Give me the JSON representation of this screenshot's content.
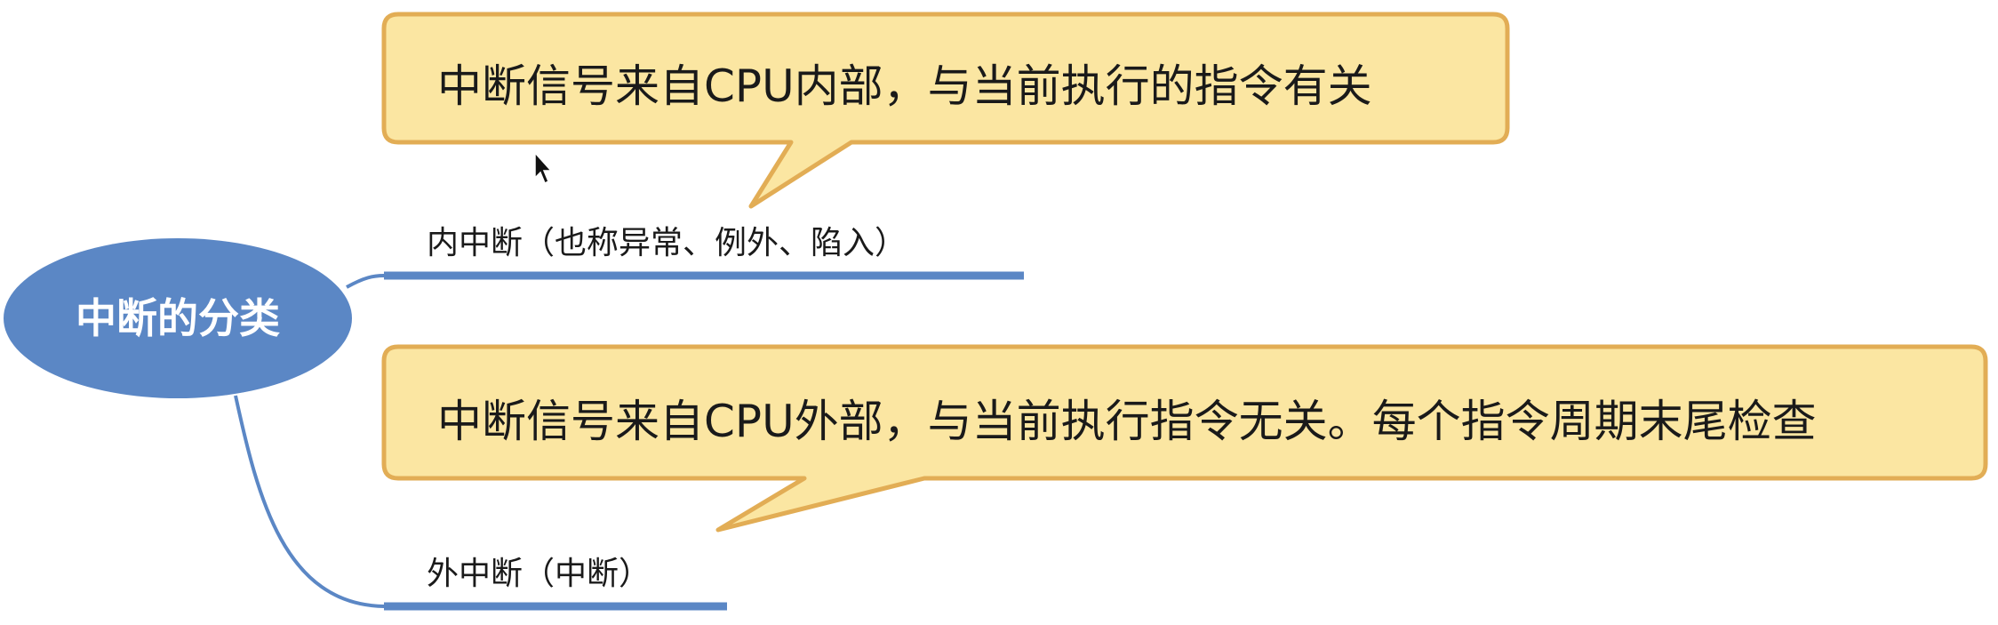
{
  "mindmap": {
    "root": {
      "label": "中断的分类"
    },
    "branches": [
      {
        "label": "内中断（也称异常、例外、陷入）",
        "note": "中断信号来自CPU内部，与当前执行的指令有关"
      },
      {
        "label": "外中断（中断）",
        "note": "中断信号来自CPU外部，与当前执行指令无关。每个指令周期末尾检查"
      }
    ]
  },
  "colors": {
    "root_fill": "#5b87c5",
    "connector": "#5b87c5",
    "callout_fill": "#fbe6a2",
    "callout_border": "#e2ad55",
    "text": "#1a1a1a"
  }
}
